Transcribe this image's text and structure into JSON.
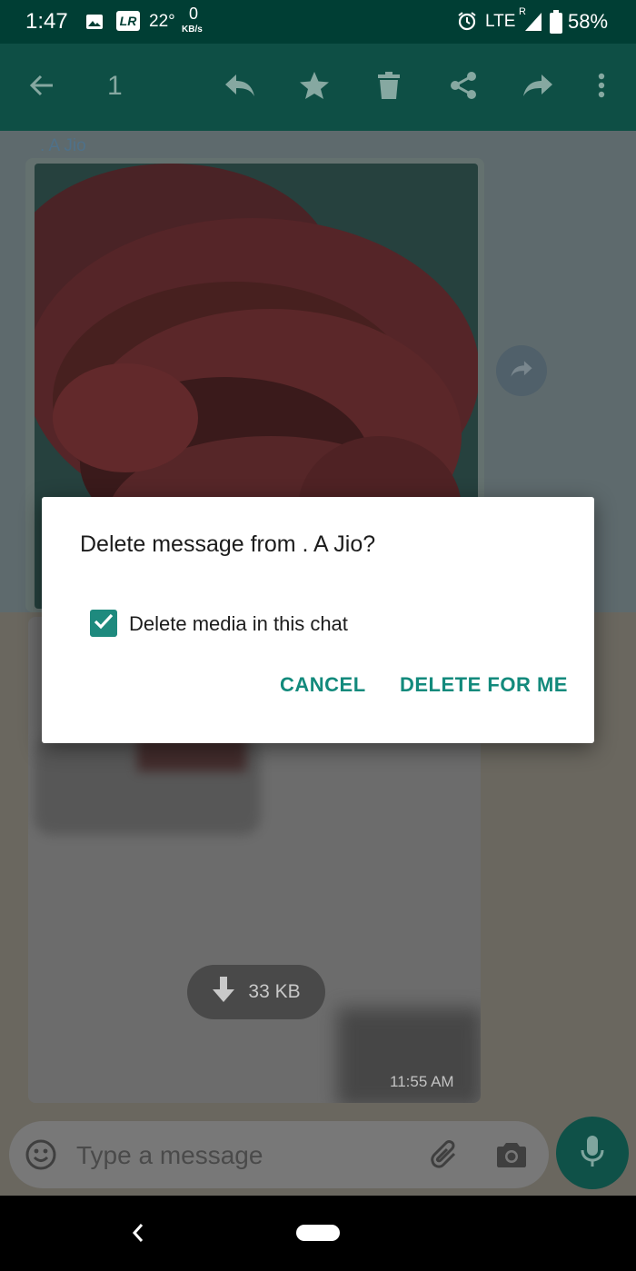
{
  "status_bar": {
    "time": "1:47",
    "lr_badge": "LR",
    "temperature": "22°",
    "net_speed_value": "0",
    "net_speed_unit": "KB/s",
    "network": "LTE",
    "roaming": "R",
    "battery": "58%"
  },
  "action_bar": {
    "selected_count": "1",
    "icons": [
      "back-arrow-icon",
      "reply-icon",
      "star-icon",
      "delete-icon",
      "share-icon",
      "forward-icon",
      "more-options-icon"
    ]
  },
  "chat": {
    "sender_name": ". A Jio",
    "download_size": "33 KB",
    "message_time": "11:55 AM"
  },
  "input": {
    "placeholder": "Type a message"
  },
  "dialog": {
    "title": "Delete message from . A Jio?",
    "checkbox_label": "Delete media in this chat",
    "checkbox_checked": true,
    "cancel_label": "CANCEL",
    "delete_label": "DELETE FOR ME"
  },
  "colors": {
    "accent": "#138a7c",
    "action_bar": "#0e4f45",
    "status_bar": "#003e34"
  }
}
